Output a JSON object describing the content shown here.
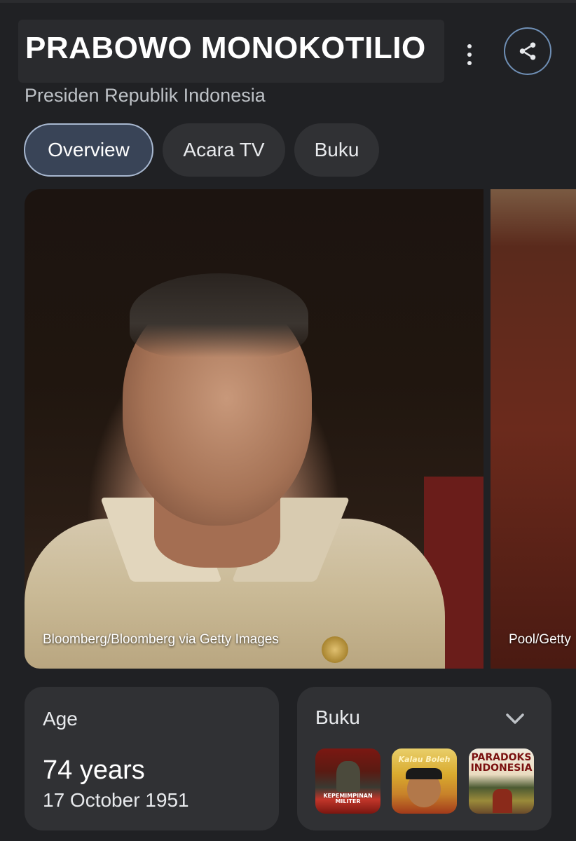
{
  "header": {
    "title": "PRABOWO MONOKOTILIO",
    "subtitle": "Presiden Republik Indonesia",
    "more_icon": "more-vert-icon",
    "share_icon": "share-icon"
  },
  "tabs": [
    {
      "label": "Overview",
      "active": true
    },
    {
      "label": "Acara TV",
      "active": false
    },
    {
      "label": "Buku",
      "active": false
    }
  ],
  "images": [
    {
      "credit": "Bloomberg/Bloomberg via Getty Images"
    },
    {
      "credit": "Pool/Getty"
    }
  ],
  "age_card": {
    "label": "Age",
    "value": "74 years",
    "date": "17 October 1951"
  },
  "buku_card": {
    "label": "Buku",
    "expand_icon": "chevron-down-icon",
    "books": [
      {
        "cover_text": "KEPEMIMPINAN MILITER"
      },
      {
        "cover_text": "Kalau Boleh"
      },
      {
        "cover_text": "PARADOKS INDONESIA"
      }
    ]
  },
  "colors": {
    "background": "#202124",
    "card": "#303134",
    "active_chip": "#394457",
    "share_ring": "#6f8fb5"
  }
}
